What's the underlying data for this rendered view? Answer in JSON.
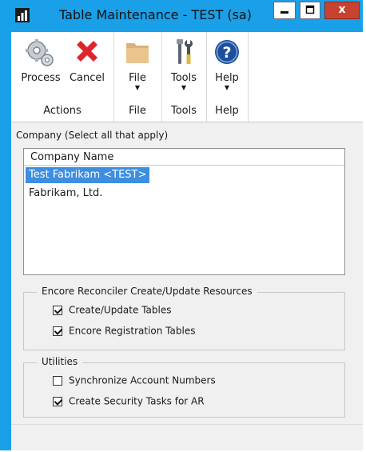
{
  "window": {
    "title": "Table Maintenance  -  TEST (sa)",
    "min_glyph": "—",
    "max_glyph": "□",
    "close_glyph": "x"
  },
  "ribbon": {
    "groups": [
      {
        "name": "Actions",
        "buttons": [
          {
            "label": "Process",
            "icon": "process-gears-icon"
          },
          {
            "label": "Cancel",
            "icon": "cancel-x-icon"
          }
        ]
      },
      {
        "name": "File",
        "buttons": [
          {
            "label": "File",
            "icon": "folder-icon"
          }
        ]
      },
      {
        "name": "Tools",
        "buttons": [
          {
            "label": "Tools",
            "icon": "tools-icon"
          }
        ]
      },
      {
        "name": "Help",
        "buttons": [
          {
            "label": "Help",
            "icon": "help-icon"
          }
        ]
      }
    ]
  },
  "company": {
    "label": "Company (Select all that apply)",
    "column_header": "Company Name",
    "rows": [
      {
        "name": "Test Fabrikam <TEST>",
        "selected": true
      },
      {
        "name": "Fabrikam, Ltd.",
        "selected": false
      }
    ]
  },
  "encore": {
    "title": "Encore Reconciler Create/Update Resources",
    "options": [
      {
        "label": "Create/Update Tables",
        "checked": true
      },
      {
        "label": "Encore Registration Tables",
        "checked": true
      }
    ]
  },
  "utilities": {
    "title": "Utilities",
    "options": [
      {
        "label": "Synchronize Account Numbers",
        "checked": false
      },
      {
        "label": "Create Security Tasks for AR",
        "checked": true
      }
    ]
  },
  "colors": {
    "accent": "#19a0e8",
    "selection": "#3d8ee0",
    "close": "#c7432f"
  }
}
